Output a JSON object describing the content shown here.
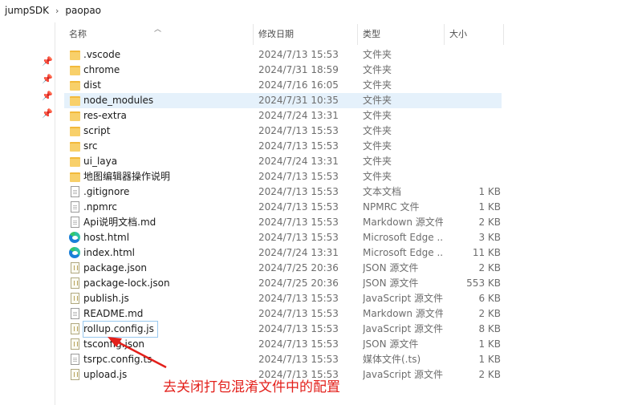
{
  "breadcrumb": {
    "items": [
      "jumpSDK",
      "paopao"
    ],
    "separator": "›"
  },
  "columns": {
    "name": "名称",
    "date": "修改日期",
    "type": "类型",
    "size": "大小"
  },
  "rows": [
    {
      "name": ".vscode",
      "date": "2024/7/13 15:53",
      "type": "文件夹",
      "size": "",
      "icon": "folder-icon"
    },
    {
      "name": "chrome",
      "date": "2024/7/31 18:59",
      "type": "文件夹",
      "size": "",
      "icon": "folder-icon"
    },
    {
      "name": "dist",
      "date": "2024/7/16 16:05",
      "type": "文件夹",
      "size": "",
      "icon": "folder-icon"
    },
    {
      "name": "node_modules",
      "date": "2024/7/31 10:35",
      "type": "文件夹",
      "size": "",
      "icon": "folder-icon",
      "selected": true
    },
    {
      "name": "res-extra",
      "date": "2024/7/24 13:31",
      "type": "文件夹",
      "size": "",
      "icon": "folder-icon"
    },
    {
      "name": "script",
      "date": "2024/7/13 15:53",
      "type": "文件夹",
      "size": "",
      "icon": "folder-icon"
    },
    {
      "name": "src",
      "date": "2024/7/13 15:53",
      "type": "文件夹",
      "size": "",
      "icon": "folder-icon"
    },
    {
      "name": "ui_laya",
      "date": "2024/7/24 13:31",
      "type": "文件夹",
      "size": "",
      "icon": "folder-icon"
    },
    {
      "name": "地图编辑器操作说明",
      "date": "2024/7/13 15:53",
      "type": "文件夹",
      "size": "",
      "icon": "folder-icon"
    },
    {
      "name": ".gitignore",
      "date": "2024/7/13 15:53",
      "type": "文本文档",
      "size": "1 KB",
      "icon": "file-icon"
    },
    {
      "name": ".npmrc",
      "date": "2024/7/13 15:53",
      "type": "NPMRC 文件",
      "size": "1 KB",
      "icon": "file-icon"
    },
    {
      "name": "Api说明文档.md",
      "date": "2024/7/13 15:53",
      "type": "Markdown 源文件",
      "size": "2 KB",
      "icon": "file-icon"
    },
    {
      "name": "host.html",
      "date": "2024/7/13 15:53",
      "type": "Microsoft Edge ...",
      "size": "3 KB",
      "icon": "edge-icon"
    },
    {
      "name": "index.html",
      "date": "2024/7/24 13:31",
      "type": "Microsoft Edge ...",
      "size": "11 KB",
      "icon": "edge-icon"
    },
    {
      "name": "package.json",
      "date": "2024/7/25 20:36",
      "type": "JSON 源文件",
      "size": "2 KB",
      "icon": "code-icon"
    },
    {
      "name": "package-lock.json",
      "date": "2024/7/25 20:36",
      "type": "JSON 源文件",
      "size": "553 KB",
      "icon": "code-icon"
    },
    {
      "name": "publish.js",
      "date": "2024/7/13 15:53",
      "type": "JavaScript 源文件",
      "size": "6 KB",
      "icon": "code-icon"
    },
    {
      "name": "README.md",
      "date": "2024/7/13 15:53",
      "type": "Markdown 源文件",
      "size": "2 KB",
      "icon": "file-icon"
    },
    {
      "name": "rollup.config.js",
      "date": "2024/7/13 15:53",
      "type": "JavaScript 源文件",
      "size": "8 KB",
      "icon": "code-icon",
      "boxed": true
    },
    {
      "name": "tsconfig.json",
      "date": "2024/7/13 15:53",
      "type": "JSON 源文件",
      "size": "1 KB",
      "icon": "code-icon"
    },
    {
      "name": "tsrpc.config.ts",
      "date": "2024/7/13 15:53",
      "type": "媒体文件(.ts)",
      "size": "1 KB",
      "icon": "file-icon"
    },
    {
      "name": "upload.js",
      "date": "2024/7/13 15:53",
      "type": "JavaScript 源文件",
      "size": "2 KB",
      "icon": "code-icon"
    }
  ],
  "annotation": {
    "text": "去关闭打包混淆文件中的配置",
    "color": "#e3201b"
  },
  "colors": {
    "selected_row": "#e5f1fb",
    "folder": "#f8d06a",
    "annotation": "#e3201b"
  }
}
